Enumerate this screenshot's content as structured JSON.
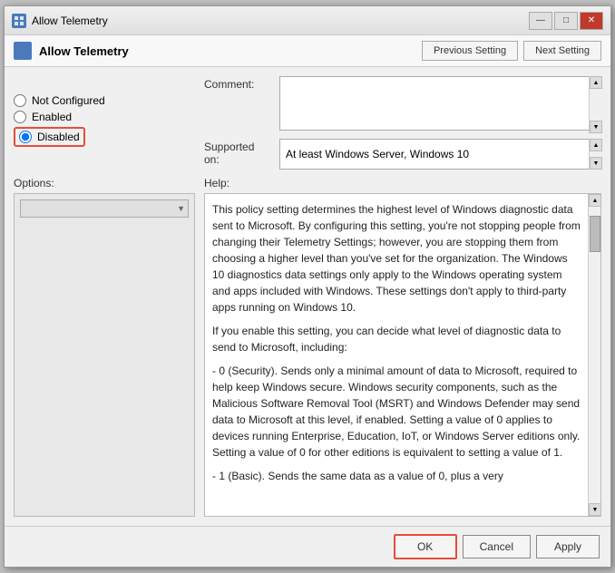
{
  "window": {
    "title": "Allow Telemetry",
    "icon": "gp"
  },
  "header": {
    "title": "Allow Telemetry",
    "prev_button": "Previous Setting",
    "next_button": "Next Setting"
  },
  "radio_options": {
    "not_configured": "Not Configured",
    "enabled": "Enabled",
    "disabled": "Disabled",
    "selected": "disabled"
  },
  "comment": {
    "label": "Comment:",
    "value": "",
    "placeholder": ""
  },
  "supported": {
    "label": "Supported on:",
    "value": "At least Windows Server, Windows 10"
  },
  "sections": {
    "options_label": "Options:",
    "help_label": "Help:"
  },
  "help_text": {
    "para1": "This policy setting determines the highest level of Windows diagnostic data sent to Microsoft. By configuring this setting, you're not stopping people from changing their Telemetry Settings; however, you are stopping them from choosing a higher level than you've set for the organization. The Windows 10 diagnostics data settings only apply to the Windows operating system and apps included with Windows. These settings don't apply to third-party apps running on Windows 10.",
    "para2": "If you enable this setting, you can decide what level of diagnostic data to send to Microsoft, including:",
    "para3": "  - 0 (Security). Sends only a minimal amount of data to Microsoft, required to help keep Windows secure. Windows security components, such as the Malicious Software Removal Tool (MSRT) and Windows Defender may send data to Microsoft at this level, if enabled. Setting a value of 0 applies to devices running Enterprise, Education, IoT, or Windows Server editions only. Setting a value of 0 for other editions is equivalent to setting a value of 1.",
    "para4": "  - 1 (Basic). Sends the same data as a value of 0, plus a very"
  },
  "buttons": {
    "ok": "OK",
    "cancel": "Cancel",
    "apply": "Apply"
  },
  "title_controls": {
    "minimize": "—",
    "maximize": "□",
    "close": "✕"
  }
}
